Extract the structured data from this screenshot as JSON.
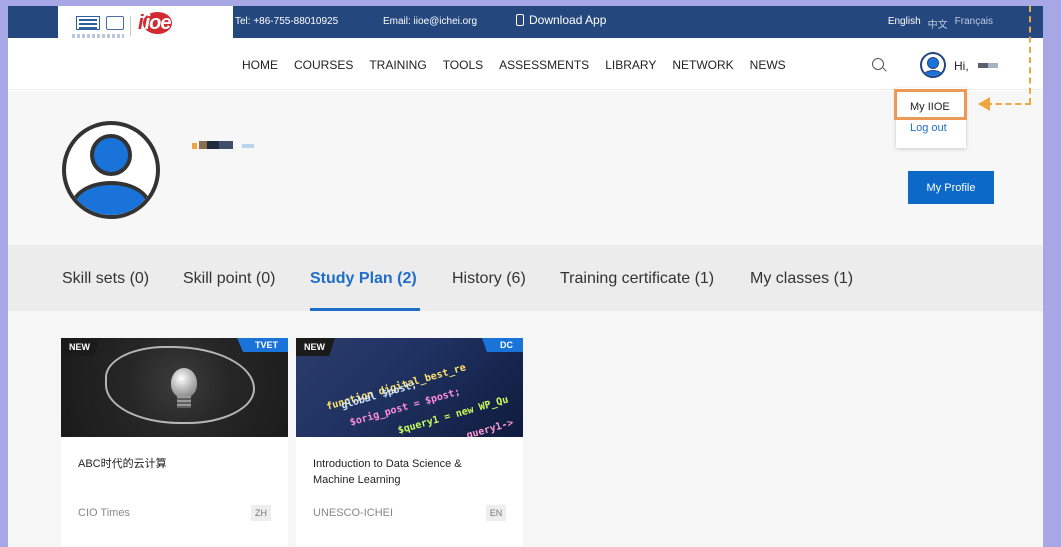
{
  "topbar": {
    "tel": "Tel: +86-755-88010925",
    "email": "Email: iioe@ichei.org",
    "download": "Download App",
    "languages": [
      "English",
      "中文",
      "Français"
    ]
  },
  "logo": {
    "brand": "ioe"
  },
  "nav": {
    "items": [
      "HOME",
      "COURSES",
      "TRAINING",
      "TOOLS",
      "ASSESSMENTS",
      "LIBRARY",
      "NETWORK",
      "NEWS"
    ],
    "greeting": "Hi,"
  },
  "user_menu": {
    "items": [
      "My IIOE",
      "Log out"
    ]
  },
  "profile": {
    "button": "My Profile"
  },
  "tabs": [
    {
      "label": "Skill sets (0)",
      "active": false
    },
    {
      "label": "Skill point (0)",
      "active": false
    },
    {
      "label": "Study Plan (2)",
      "active": true
    },
    {
      "label": "History (6)",
      "active": false
    },
    {
      "label": "Training certificate (1)",
      "active": false
    },
    {
      "label": "My classes (1)",
      "active": false
    }
  ],
  "courses": [
    {
      "badge": "NEW",
      "category": "TVET",
      "title": "ABC时代的云计算",
      "org": "CIO Times",
      "lang": "ZH",
      "image": "lightbulb-image"
    },
    {
      "badge": "NEW",
      "category": "DC",
      "title": "Introduction to Data Science & Machine Learning",
      "org": "UNESCO-ICHEI",
      "lang": "EN",
      "image": "code-image",
      "image_text": [
        "function digital_best_re",
        "global $post;",
        "$orig_post = $post;",
        "$query1 = new WP_Qu",
        "query1->"
      ]
    }
  ],
  "colors": {
    "header_bg": "#24487e",
    "accent": "#1e6ec8",
    "button": "#0c69c8",
    "highlight": "#ea9a56",
    "frame": "#a7a7e6"
  }
}
